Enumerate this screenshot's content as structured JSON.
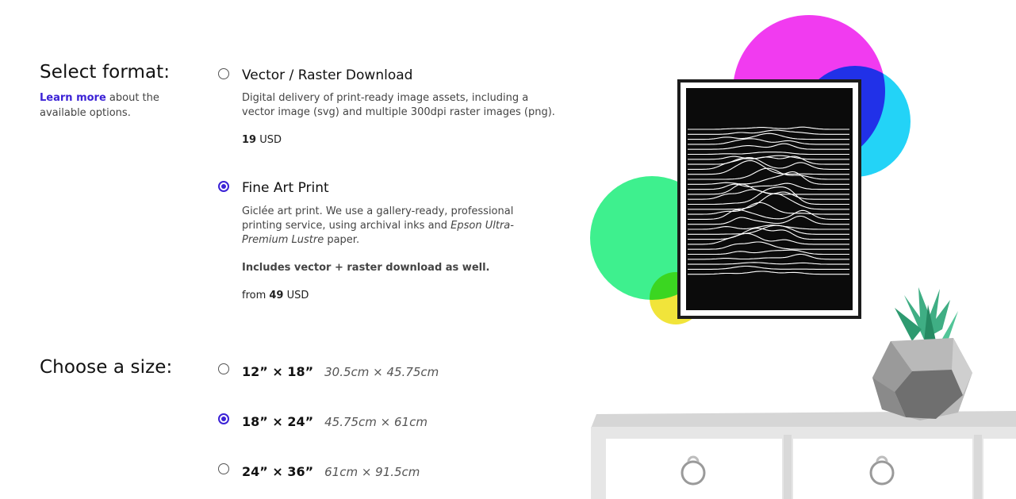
{
  "format": {
    "heading": "Select format:",
    "learn_link": "Learn more",
    "learn_rest": " about the available options.",
    "options": [
      {
        "title": "Vector / Raster Download",
        "description": "Digital delivery of print-ready image assets, including a vector image (svg) and multiple 300dpi raster images (png).",
        "price_prefix": "",
        "price_value": "19",
        "price_unit": " USD",
        "selected": false
      },
      {
        "title": "Fine Art Print",
        "description_start": "Giclée art print. We use a gallery-ready, professional printing service, using archival inks and ",
        "description_italic": "Epson Ultra-Premium Lustre",
        "description_end": " paper.",
        "note": "Includes vector + raster download as well.",
        "price_prefix": "from ",
        "price_value": "49",
        "price_unit": " USD",
        "selected": true
      }
    ]
  },
  "size": {
    "heading": "Choose a size:",
    "options": [
      {
        "imperial": "12” × 18”",
        "metric": "30.5cm × 45.75cm",
        "selected": false
      },
      {
        "imperial": "18” × 24”",
        "metric": "45.75cm × 61cm",
        "selected": true
      },
      {
        "imperial": "24” × 36”",
        "metric": "61cm × 91.5cm",
        "selected": false
      }
    ]
  },
  "colors": {
    "accent": "#3b22d6",
    "magenta": "#f13bf0",
    "cyan": "#23d3f7",
    "green": "#3ef08e",
    "yellow": "#f1e43a"
  }
}
